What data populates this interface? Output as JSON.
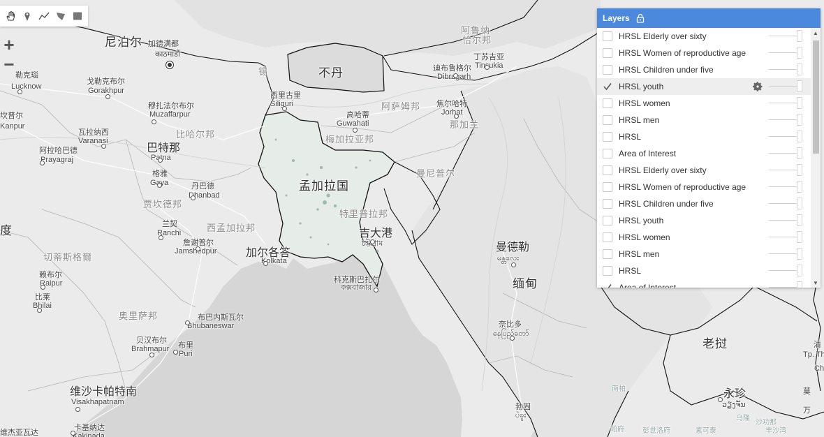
{
  "toolbar": {
    "tools": [
      {
        "name": "pan-hand-icon"
      },
      {
        "name": "point-marker-icon"
      },
      {
        "name": "line-draw-icon"
      },
      {
        "name": "polygon-draw-icon"
      },
      {
        "name": "rectangle-draw-icon"
      }
    ]
  },
  "zoom": {
    "in_label": "+",
    "out_label": "−"
  },
  "layers": {
    "title": "Layers",
    "items": [
      {
        "label": "HRSL Elderly over sixty",
        "checked": false
      },
      {
        "label": "HRSL Women of reproductive age",
        "checked": false
      },
      {
        "label": "HRSL Children under five",
        "checked": false
      },
      {
        "label": "HRSL youth",
        "checked": true
      },
      {
        "label": "HRSL women",
        "checked": false
      },
      {
        "label": "HRSL men",
        "checked": false
      },
      {
        "label": "HRSL",
        "checked": false
      },
      {
        "label": "Area of Interest",
        "checked": false
      },
      {
        "label": "HRSL Elderly over sixty",
        "checked": false
      },
      {
        "label": "HRSL Women of reproductive age",
        "checked": false
      },
      {
        "label": "HRSL Children under five",
        "checked": false
      },
      {
        "label": "HRSL youth",
        "checked": false
      },
      {
        "label": "HRSL women",
        "checked": false
      },
      {
        "label": "HRSL men",
        "checked": false
      },
      {
        "label": "HRSL",
        "checked": false
      },
      {
        "label": "Area of Interest",
        "checked": true
      }
    ]
  },
  "map": {
    "labels": {
      "nepal": "尼泊尔",
      "kathmandu_zh": "加德满都",
      "kathmandu_local": "काठमाडौं",
      "bhutan": "不丹",
      "bangladesh": "孟加拉国",
      "myanmar": "缅甸",
      "laos": "老挝",
      "lucknow_zh": "勒克瑙",
      "lucknow": "Lucknow",
      "gorakhpur_zh": "戈勒克布尔",
      "gorakhpur": "Gorakhpur",
      "kanpur_zh": "坎普尔",
      "kanpur": "Kanpur",
      "muzaffarpur_zh": "穆扎法尔布尔",
      "muzaffarpur": "Muzaffarpur",
      "varanasi_zh": "瓦拉纳西",
      "varanasi": "Varanasi",
      "bihar": "比哈尔邦",
      "patna_zh": "巴特那",
      "patna": "Patna",
      "prayagraj_zh": "阿拉哈巴德",
      "prayagraj": "Prayagraj",
      "gaya_zh": "格雅",
      "gaya": "Gaya",
      "dhanbad_zh": "丹巴德",
      "dhanbad": "Dhanbad",
      "jharkhand": "贾坎德邦",
      "ranchi_zh": "兰契",
      "ranchi": "Ranchi",
      "west_bengal": "西孟加拉邦",
      "jamshedpur_zh": "詹谢普尔",
      "jamshedpur": "Jamshedpur",
      "kolkata_zh": "加尔各答",
      "kolkata": "Kolkata",
      "chhattisgarh": "切蒂斯格爾",
      "raipur_zh": "赖布尔",
      "raipur": "Raipur",
      "bhilai_zh": "比莱",
      "bhilai": "Bhilai",
      "odisha": "奥里萨邦",
      "bhubaneswar_zh": "布巴内斯瓦尔",
      "bhubaneswar": "Bhubaneswar",
      "brahmapur_zh": "贝汉布尔",
      "brahmapur": "Brahmapur",
      "puri_zh": "布里",
      "puri": "Puri",
      "visakhapatnam_zh": "维沙卡帕特南",
      "visakhapatnam": "Visakhapatnam",
      "kakinada_zh": "卡基纳达",
      "kakinada": "Kakinada",
      "vijayawada_zh": "维杰亚瓦达",
      "sikkim": "锡",
      "siliguri_zh": "西里古里",
      "siliguri": "Siliguri",
      "guwahati_zh": "高哈蒂",
      "guwahati": "Guwahati",
      "meghalaya": "梅加拉亚邦",
      "assam": "阿萨姆邦",
      "arunachal": "阿鲁纳",
      "arunachal2": "恰尔邦",
      "tinsukia_zh": "丁苏吉亚",
      "tinsukia": "Tinsukia",
      "dibrugarh_zh": "迪布鲁格尔",
      "dibrugarh": "Dibrugarh",
      "jorhat_zh": "焦尔哈特",
      "jorhat": "Jorhat",
      "nagaland": "那加兰",
      "manipur": "曼尼普尔",
      "tripura": "特里普拉邦",
      "chittagong_zh": "吉大港",
      "chittagong_local": "চট্টগ্রাম",
      "coxsbazar_zh": "科克斯巴扎尔",
      "coxsbazar_local": "কক্সবাজার",
      "mandalay_zh": "曼德勒",
      "mandalay_local": "မန္တလေး",
      "naypyidaw_zh": "奈比多",
      "naypyidaw_local": "နေပြည်တော်",
      "bago_zh": "勃固",
      "bago_local": "ပဲခူး",
      "vientiane_zh": "永珍",
      "vientiane_local": "ວຽງຈັນ",
      "nanpa": "南帕",
      "chiang_mai_fragment": "清",
      "th_fragment": "Tp. Th",
      "china_fragment": "Ch",
      "moei": "莫",
      "nong_fragment": "乌隆",
      "sakhon": "沙功那",
      "thai1": "帕府",
      "thai2": "彭世洛府",
      "thai3": "素可泰",
      "laos_s": "乌隆",
      "partial_country": "度",
      "sanai": "万",
      "s1": "丰沙湾"
    }
  }
}
